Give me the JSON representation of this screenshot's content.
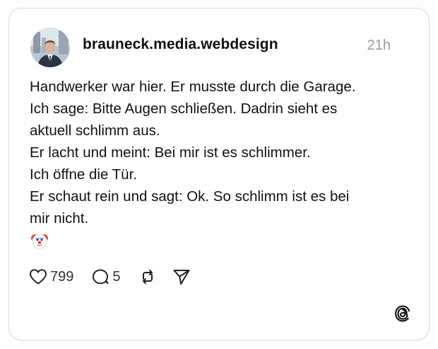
{
  "post": {
    "username": "brauneck.media.webdesign",
    "timestamp": "21h",
    "lines": [
      "Handwerker war hier. Er musste durch die Garage.",
      "Ich sage: Bitte Augen schließen. Dadrin sieht es",
      "aktuell schlimm aus.",
      "Er lacht und meint: Bei mir ist es schlimmer.",
      "Ich öffne die Tür.",
      "Er schaut rein und sagt: Ok. So schlimm ist es bei",
      "mir nicht."
    ],
    "emoji_icon": "clown-face-icon"
  },
  "actions": {
    "likes": "799",
    "comments": "5",
    "like_icon": "heart-icon",
    "comment_icon": "speech-bubble-icon",
    "repost_icon": "repost-icon",
    "share_icon": "send-icon"
  },
  "brand": {
    "logo_icon": "threads-logo-icon"
  }
}
